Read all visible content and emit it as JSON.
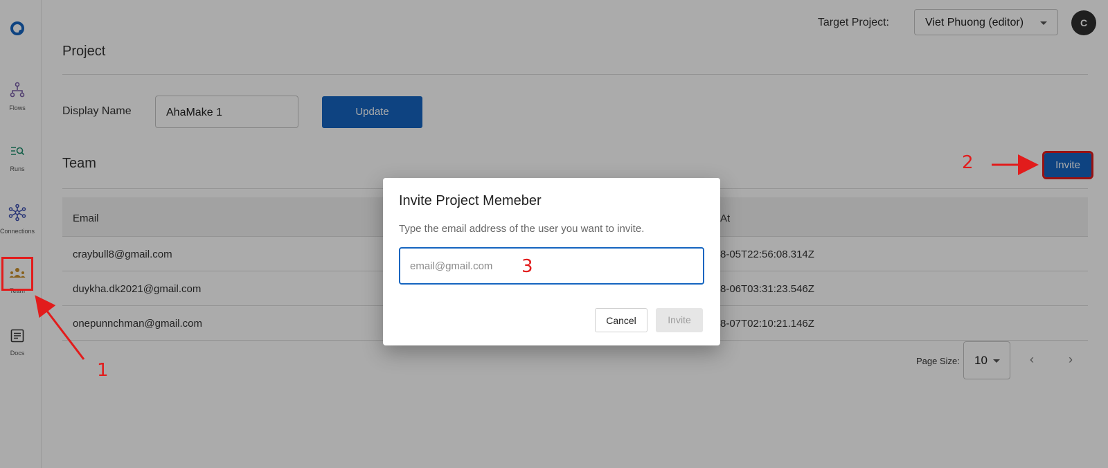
{
  "sidebar": {
    "items": [
      {
        "label": "Flows"
      },
      {
        "label": "Runs"
      },
      {
        "label": "Connections"
      },
      {
        "label": "Team"
      },
      {
        "label": "Docs"
      }
    ]
  },
  "topbar": {
    "target_project_label": "Target Project:",
    "target_project_value": "Viet Phuong (editor)",
    "avatar_initial": "C"
  },
  "project": {
    "title": "Project",
    "display_name_label": "Display Name",
    "display_name_value": "AhaMake 1",
    "update_label": "Update"
  },
  "team": {
    "title": "Team",
    "invite_label": "Invite",
    "columns": [
      "Email",
      "At"
    ],
    "rows": [
      {
        "email": "craybull8@gmail.com",
        "at": "8-05T22:56:08.314Z"
      },
      {
        "email": "duykha.dk2021@gmail.com",
        "at": "8-06T03:31:23.546Z"
      },
      {
        "email": "onepunnchman@gmail.com",
        "at": "8-07T02:10:21.146Z"
      }
    ],
    "page_size_label": "Page Size:",
    "page_size_value": "10"
  },
  "modal": {
    "title": "Invite Project Memeber",
    "description": "Type the email address of the user you want to invite.",
    "email_placeholder": "email@gmail.com",
    "cancel_label": "Cancel",
    "invite_label": "Invite"
  },
  "annotations": {
    "step1": "1",
    "step2": "2",
    "step3": "3",
    "color": "#e21c1c"
  },
  "colors": {
    "primary": "#1565c0",
    "overlay": "rgba(0,0,0,0.33)"
  }
}
